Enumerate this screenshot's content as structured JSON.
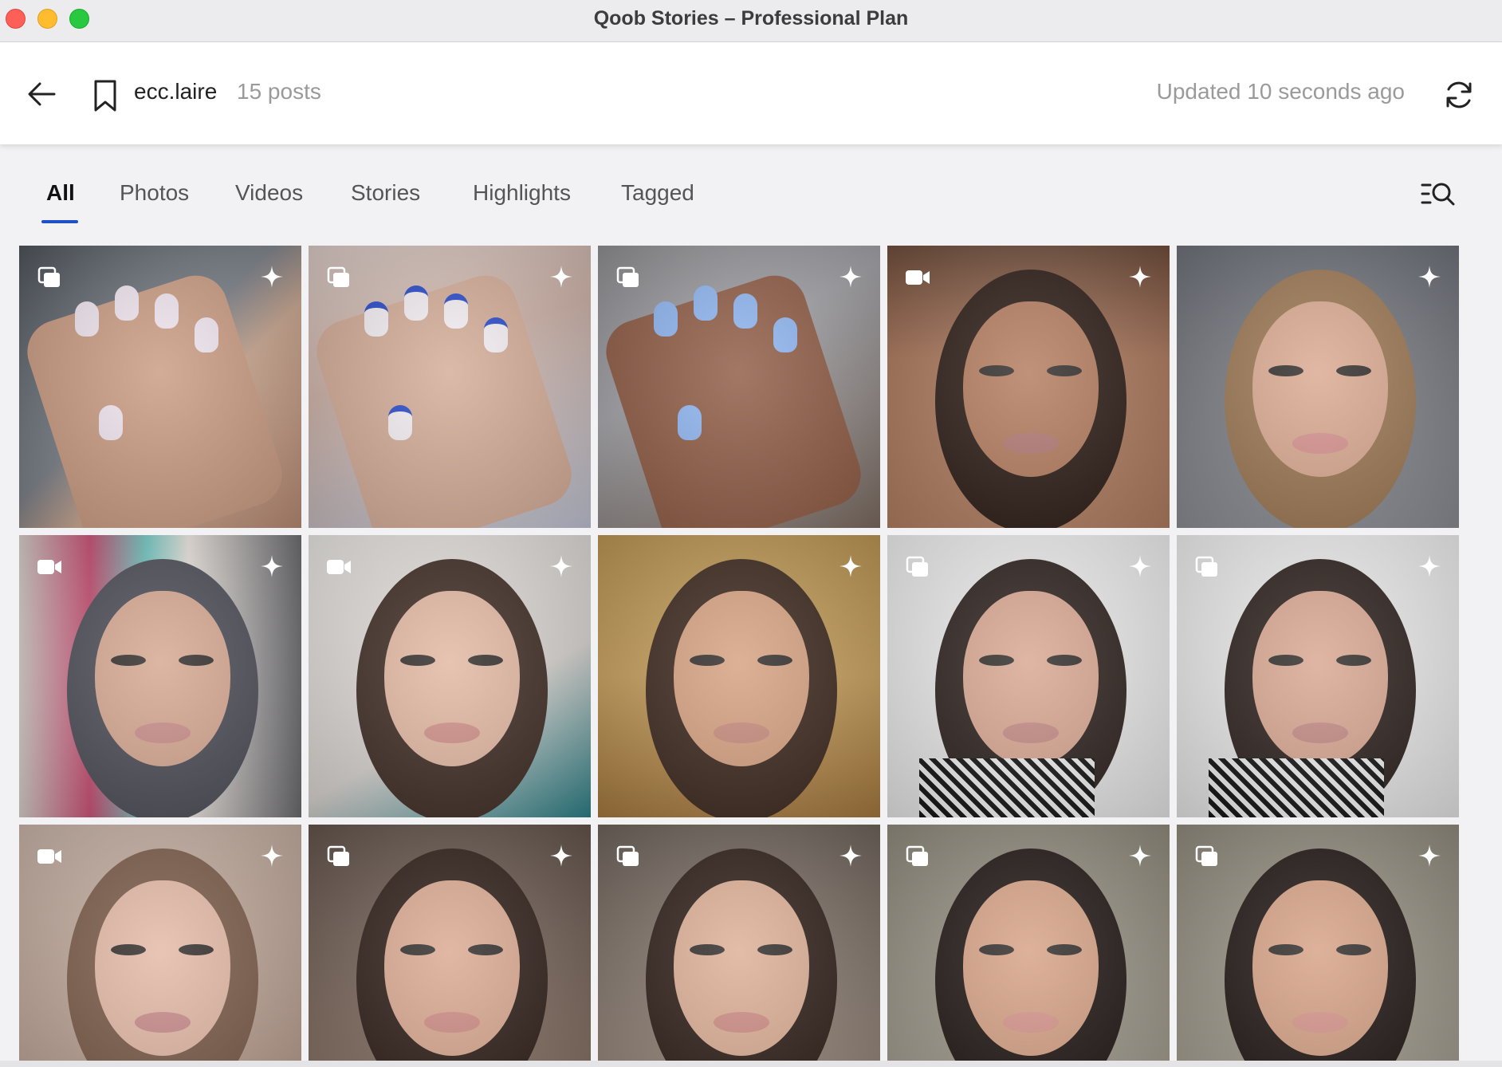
{
  "window": {
    "title": "Qoob Stories – Professional Plan"
  },
  "header": {
    "username": "ecc.laire",
    "post_count": "15 posts",
    "updated": "Updated 10 seconds ago"
  },
  "tabs": [
    {
      "label": "All",
      "active": true
    },
    {
      "label": "Photos",
      "active": false
    },
    {
      "label": "Videos",
      "active": false
    },
    {
      "label": "Stories",
      "active": false
    },
    {
      "label": "Highlights",
      "active": false
    },
    {
      "label": "Tagged",
      "active": false
    }
  ],
  "colors": {
    "accent": "#1e50c8"
  },
  "icons": {
    "back": "arrow-left-icon",
    "bookmark": "bookmark-icon",
    "refresh": "refresh-icon",
    "filter": "filter-search-icon",
    "carousel": "carousel-icon",
    "video": "video-camera-icon",
    "sparkle": "sparkle-icon"
  },
  "posts": [
    {
      "type": "carousel",
      "subject": "nails"
    },
    {
      "type": "carousel",
      "subject": "nails"
    },
    {
      "type": "carousel",
      "subject": "nails"
    },
    {
      "type": "video",
      "subject": "portrait"
    },
    {
      "type": "none",
      "subject": "portrait"
    },
    {
      "type": "video",
      "subject": "portrait"
    },
    {
      "type": "video",
      "subject": "portrait"
    },
    {
      "type": "none",
      "subject": "portrait"
    },
    {
      "type": "carousel",
      "subject": "portrait"
    },
    {
      "type": "carousel",
      "subject": "portrait"
    },
    {
      "type": "video",
      "subject": "portrait"
    },
    {
      "type": "carousel",
      "subject": "portrait"
    },
    {
      "type": "carousel",
      "subject": "portrait"
    },
    {
      "type": "carousel",
      "subject": "portrait"
    },
    {
      "type": "carousel",
      "subject": "portrait"
    }
  ]
}
